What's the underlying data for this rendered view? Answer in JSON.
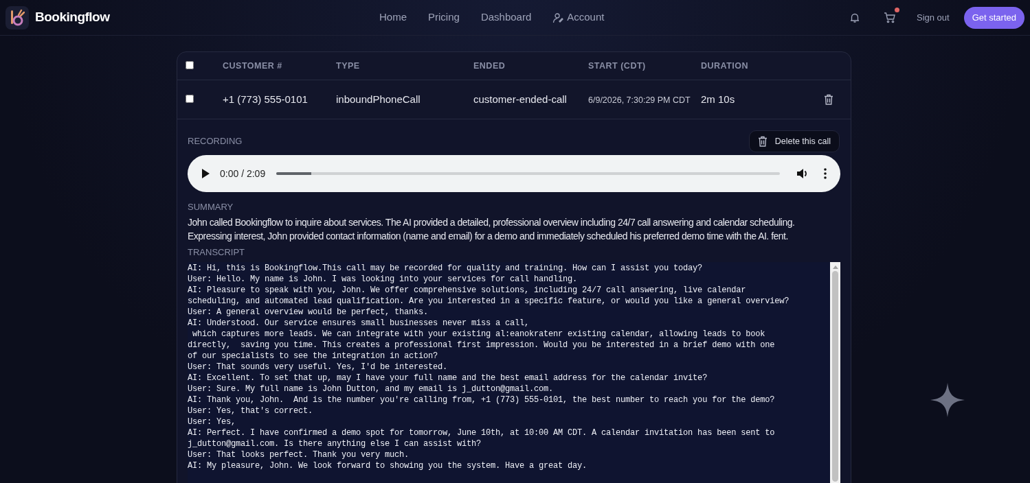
{
  "header": {
    "brand": "Bookingflow",
    "nav": [
      {
        "label": "Home",
        "kind": "link"
      },
      {
        "label": "Pricing",
        "kind": "link"
      },
      {
        "label": "Dashboard",
        "kind": "link"
      },
      {
        "label": "Account",
        "kind": "account"
      }
    ],
    "cart_badge": true,
    "sign_out": "Sign out",
    "cta": "Get started"
  },
  "table": {
    "select_all": {
      "checked": false
    },
    "columns": [
      "CUSTOMER #",
      "TYPE",
      "ENDED",
      "START (CDT)",
      "DURATION"
    ],
    "rows": [
      {
        "checked": false,
        "cells": [
          "+1 (773) 555-0101",
          "inboundPhoneCall",
          "customer-ended-call",
          "6/9/2026, 7:30:29 PM CDT",
          "2m 10s"
        ],
        "expanded": true
      }
    ]
  },
  "details": {
    "recording_label": "RECORDING",
    "delete_button": "Delete this call",
    "player": {
      "time": "0:00 / 2:09",
      "level": 0.07
    },
    "summary_label": "SUMMARY",
    "summary": "John called Bookingflow to inquire about services. The AI provided a detailed, professional overview including 24/7 call answering and calendar scheduling. Expressing interest, John provided contact information (name and email) for a demo and immediately scheduled his preferred demo time with the AI. fent.",
    "transcript_label": "TRANSCRIPT",
    "transcript": [
      "AI: Hi, this is Bookingflow.This call may be recorded for quality and training. How can I assist you today?",
      "User: Hello. My name is John. I was looking into your services for call handling.",
      "AI: Pleasure to speak with you, John. We offer comprehensive solutions, including 24/7 call answering, live calendar",
      "scheduling, and automated lead qualification. Are you interested in a specific feature, or would you like a general overview?",
      "User: A general overview would be perfect, thanks.",
      "AI: Understood. Our service ensures small businesses never miss a call,",
      " which captures more leads. We can integrate with your existing al:eanokratenr existing calendar, allowing leads to book",
      "directly,  saving you time. This creates a professional first impression. Would you be interested in a brief demo with one",
      "of our specialists to see the integration in action?",
      "User: That sounds very useful. Yes, I'd be interested.",
      "AI: Excellent. To set that up, may I have your full name and the best email address for the calendar invite?",
      "User: Sure. My full name is John Dutton, and my email is j_dutton@gmail.com.",
      "AI: Thank you, John.  And is the number you're calling from, +1 (773) 555-0101, the best number to reach you for the demo?",
      "User: Yes, that's correct.",
      "User: Yes,",
      "AI: Perfect. I have confirmed a demo spot for tomorrow, June 10th, at 10:00 AM CDT. A calendar invitation has been sent to",
      "j_dutton@gmail.com. Is there anything else I can assist with?",
      "User: That looks perfect. Thank you very much.",
      "AI: My pleasure, John. We look forward to showing you the system. Have a great day."
    ]
  }
}
